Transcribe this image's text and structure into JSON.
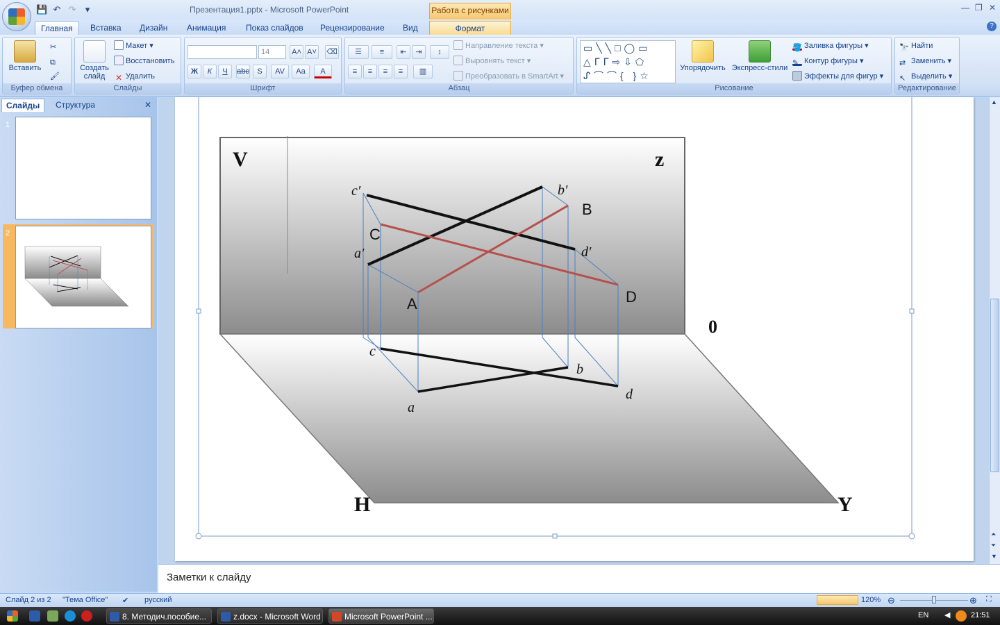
{
  "window": {
    "title": "Презентация1.pptx - Microsoft PowerPoint",
    "context_group": "Работа с рисунками"
  },
  "tabs": [
    "Главная",
    "Вставка",
    "Дизайн",
    "Анимация",
    "Показ слайдов",
    "Рецензирование",
    "Вид",
    "Формат"
  ],
  "ribbon": {
    "clipboard": {
      "paste": "Вставить",
      "label": "Буфер обмена"
    },
    "slides": {
      "new_slide": "Создать слайд",
      "layout": "Макет",
      "reset": "Восстановить",
      "delete": "Удалить",
      "label": "Слайды"
    },
    "font": {
      "font_size": "14",
      "label": "Шрифт",
      "bold": "Ж",
      "italic": "К",
      "underline": "Ч",
      "strike": "abc",
      "shadow": "S",
      "spacing": "AV",
      "case": "Aa",
      "color": "A"
    },
    "paragraph": {
      "text_direction": "Направление текста",
      "align_text": "Выровнять текст",
      "smartart": "Преобразовать в SmartArt",
      "label": "Абзац"
    },
    "drawing": {
      "arrange": "Упорядочить",
      "quick_styles": "Экспресс-стили",
      "fill": "Заливка фигуры",
      "outline": "Контур фигуры",
      "effects": "Эффекты для фигур",
      "label": "Рисование"
    },
    "editing": {
      "find": "Найти",
      "replace": "Заменить",
      "select": "Выделить",
      "label": "Редактирование"
    }
  },
  "left_panel": {
    "tab_slides": "Слайды",
    "tab_outline": "Структура",
    "slide_numbers": [
      "1",
      "2"
    ]
  },
  "slide": {
    "labels": {
      "V": "V",
      "z": "z",
      "zero": "0",
      "H": "H",
      "Y": "Y",
      "A": "A",
      "B": "B",
      "C": "C",
      "D": "D",
      "a_prime": "a′",
      "b_prime": "b′",
      "c_prime": "c′",
      "d_prime": "d′",
      "a": "a",
      "b": "b",
      "c": "c",
      "d": "d"
    },
    "colors": {
      "black_line": "#111111",
      "red_line": "#b5504d",
      "projection_line": "#4a7fc0"
    }
  },
  "notes": {
    "placeholder": "Заметки к слайду"
  },
  "status": {
    "slide_index": "Слайд 2 из 2",
    "theme": "\"Тема Office\"",
    "language": "русский",
    "zoom": "120%"
  },
  "taskbar": {
    "items": [
      "8. Методич.пособие...",
      "z.docx - Microsoft Word",
      "Microsoft PowerPoint ..."
    ],
    "lang": "EN",
    "time": "21:51"
  }
}
